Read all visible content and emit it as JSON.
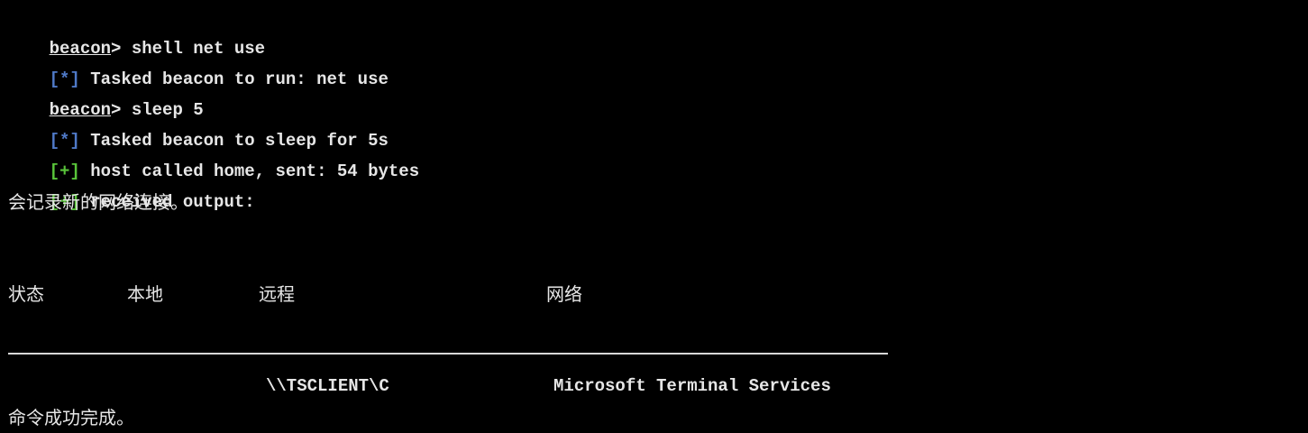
{
  "colors": {
    "background": "#000000",
    "text": "#e6e6e6",
    "info_tag": "#4f79c7",
    "success_tag": "#59c43a"
  },
  "lines": [
    {
      "prompt": "beacon",
      "sep": "> ",
      "command": "shell net use"
    },
    {
      "tag": "[*]",
      "text": " Tasked beacon to run: net use"
    },
    {
      "prompt": "beacon",
      "sep": "> ",
      "command": "sleep 5"
    },
    {
      "tag": "[*]",
      "text": " Tasked beacon to sleep for 5s"
    },
    {
      "tag": "[+]",
      "text": " host called home, sent: 54 bytes"
    },
    {
      "tag": "[+]",
      "text": " received output:"
    },
    {
      "text": "会记录新的网络连接。"
    }
  ],
  "table": {
    "headers": [
      "状态",
      "本地",
      "远程",
      "网络"
    ],
    "row": {
      "status": "",
      "local": "",
      "remote": "\\\\TSCLIENT\\C",
      "network": "Microsoft Terminal Services"
    }
  },
  "footer": "命令成功完成。"
}
